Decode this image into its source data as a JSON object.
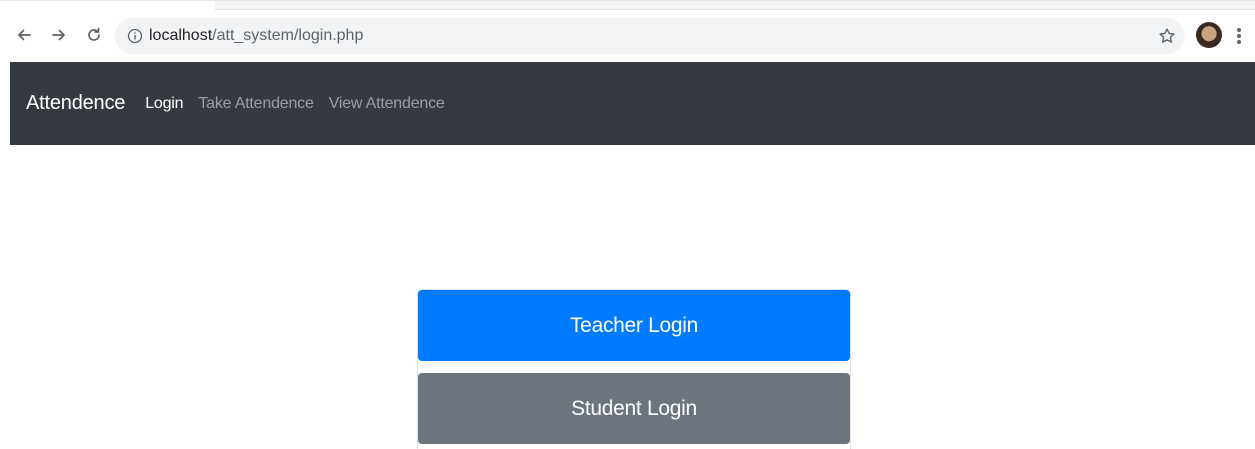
{
  "browser": {
    "url_host": "localhost",
    "url_path": "/att_system/login.php",
    "icons": {
      "back": "back-arrow-icon",
      "forward": "forward-arrow-icon",
      "reload": "reload-icon",
      "info": "info-icon",
      "bookmark": "star-icon",
      "profile": "avatar",
      "menu": "kebab-menu-icon"
    }
  },
  "navbar": {
    "brand": "Attendence",
    "links": [
      {
        "label": "Login",
        "active": true
      },
      {
        "label": "Take Attendence",
        "active": false
      },
      {
        "label": "View Attendence",
        "active": false
      }
    ],
    "background": "#343a40"
  },
  "main": {
    "teacher_login_label": "Teacher Login",
    "student_login_label": "Student Login"
  },
  "colors": {
    "primary": "#007bff",
    "secondary": "#6c757d"
  }
}
